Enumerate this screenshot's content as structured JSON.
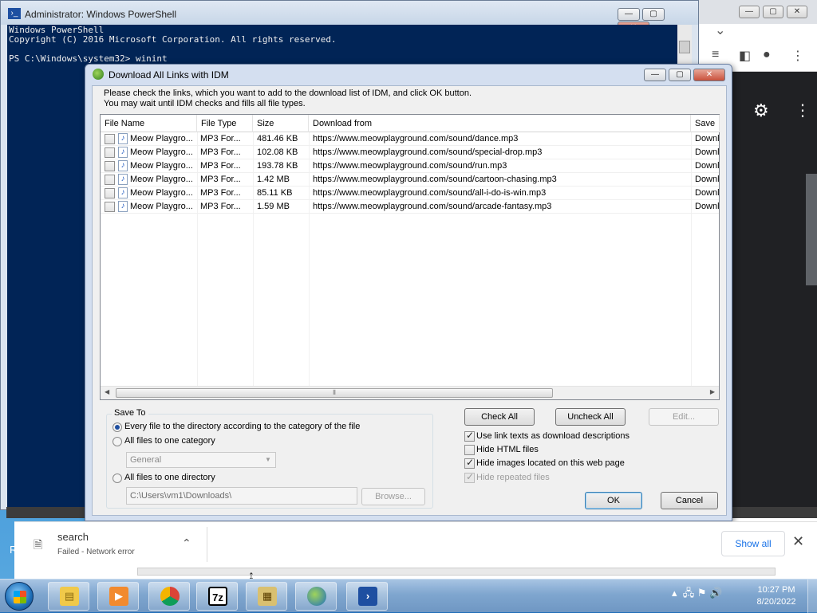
{
  "powershell": {
    "title": "Administrator: Windows PowerShell",
    "lines": [
      "Windows PowerShell",
      "Copyright (C) 2016 Microsoft Corporation. All rights reserved.",
      "",
      "PS C:\\Windows\\system32> winint"
    ]
  },
  "window_buttons": {
    "minimize": "—",
    "maximize": "▢",
    "close": "✕"
  },
  "dialog": {
    "title": "Download All Links with IDM",
    "instruction_line1": "Please check the links, which you want to add to the download list of IDM, and click OK button.",
    "instruction_line2": "You may wait until IDM checks and fills all file types.",
    "columns": [
      "File Name",
      "File Type",
      "Size",
      "Download from",
      "Save"
    ],
    "rows": [
      {
        "name": "Meow Playgro...",
        "type": "MP3 For...",
        "size": "481.46  KB",
        "url": "https://www.meowplayground.com/sound/dance.mp3",
        "save": "Downl",
        "checked": false
      },
      {
        "name": "Meow Playgro...",
        "type": "MP3 For...",
        "size": "102.08  KB",
        "url": "https://www.meowplayground.com/sound/special-drop.mp3",
        "save": "Downl",
        "checked": false
      },
      {
        "name": "Meow Playgro...",
        "type": "MP3 For...",
        "size": "193.78  KB",
        "url": "https://www.meowplayground.com/sound/run.mp3",
        "save": "Downl",
        "checked": false
      },
      {
        "name": "Meow Playgro...",
        "type": "MP3 For...",
        "size": "1.42  MB",
        "url": "https://www.meowplayground.com/sound/cartoon-chasing.mp3",
        "save": "Downl",
        "checked": false
      },
      {
        "name": "Meow Playgro...",
        "type": "MP3 For...",
        "size": "85.11  KB",
        "url": "https://www.meowplayground.com/sound/all-i-do-is-win.mp3",
        "save": "Downl",
        "checked": false
      },
      {
        "name": "Meow Playgro...",
        "type": "MP3 For...",
        "size": "1.59  MB",
        "url": "https://www.meowplayground.com/sound/arcade-fantasy.mp3",
        "save": "Downl",
        "checked": false
      }
    ],
    "save_to": {
      "legend": "Save To",
      "option_category_dir": "Every file to the directory according to the category of the file",
      "option_one_category": "All files to one category",
      "category_value": "General",
      "option_one_directory": "All files to one directory",
      "directory_value": "C:\\Users\\vm1\\Downloads\\",
      "selected": "category_dir"
    },
    "buttons": {
      "check_all": "Check All",
      "uncheck_all": "Uncheck All",
      "edit": "Edit...",
      "browse": "Browse...",
      "ok": "OK",
      "cancel": "Cancel"
    },
    "options": {
      "use_link_texts": {
        "label": "Use link texts as download descriptions",
        "checked": true
      },
      "hide_html": {
        "label": "Hide HTML files",
        "checked": false
      },
      "hide_images": {
        "label": "Hide images located on this web page",
        "checked": true
      },
      "hide_repeated": {
        "label": "Hide repeated files",
        "checked": true,
        "disabled": true
      }
    }
  },
  "download_bar": {
    "file_name": "search",
    "status": "Failed - Network error",
    "show_all": "Show all"
  },
  "taskbar": {
    "apps": [
      "file-explorer",
      "media-player",
      "chrome",
      "7zip",
      "archive-tool",
      "internet-download-manager",
      "powershell"
    ],
    "time": "10:27 PM",
    "date": "8/20/2022"
  },
  "desktop_letter": "R"
}
